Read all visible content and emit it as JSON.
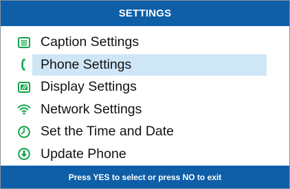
{
  "header": {
    "title": "SETTINGS"
  },
  "menu": {
    "items": [
      {
        "label": "Caption Settings",
        "icon": "caption-icon",
        "selected": false
      },
      {
        "label": "Phone Settings",
        "icon": "phone-icon",
        "selected": true
      },
      {
        "label": "Display Settings",
        "icon": "display-icon",
        "selected": false
      },
      {
        "label": "Network Settings",
        "icon": "wifi-icon",
        "selected": false
      },
      {
        "label": "Set the Time and Date",
        "icon": "clock-icon",
        "selected": false
      },
      {
        "label": "Update Phone",
        "icon": "download-icon",
        "selected": false
      }
    ]
  },
  "footer": {
    "hint": "Press YES to select or press NO to exit"
  },
  "colors": {
    "accent": "#0f5fa8",
    "icon": "#0fa34a",
    "highlight": "#cfe6f6"
  }
}
